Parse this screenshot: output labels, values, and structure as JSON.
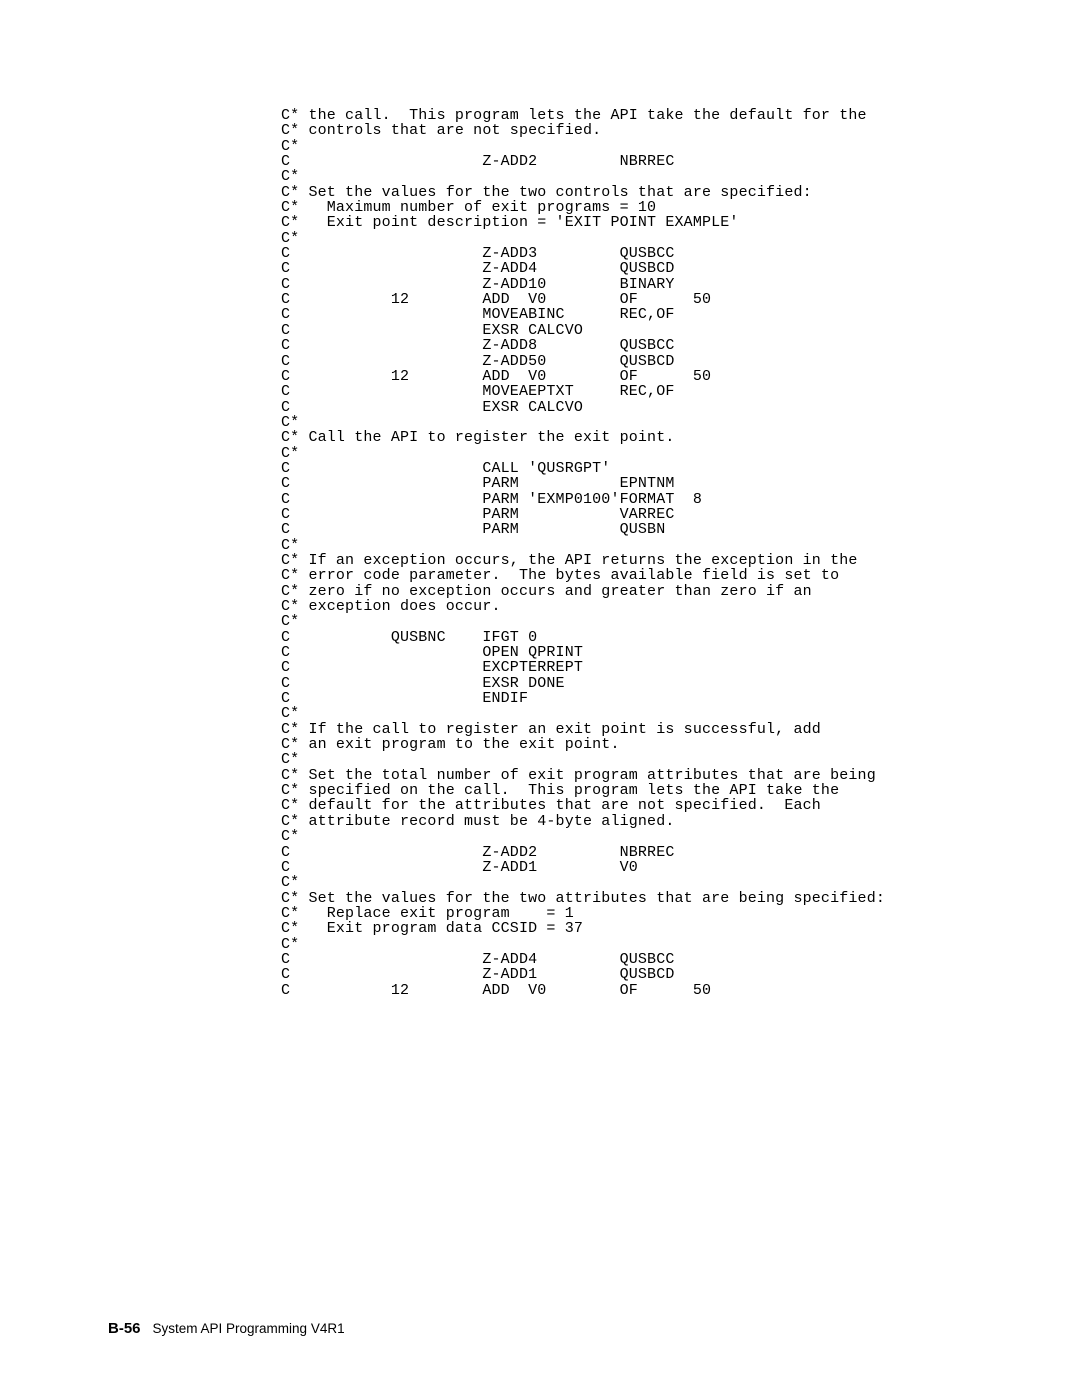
{
  "code": "C* the call.  This program lets the API take the default for the\nC* controls that are not specified.\nC*\nC                     Z-ADD2         NBRREC\nC*\nC* Set the values for the two controls that are specified:\nC*   Maximum number of exit programs = 10\nC*   Exit point description = 'EXIT POINT EXAMPLE'\nC*\nC                     Z-ADD3         QUSBCC\nC                     Z-ADD4         QUSBCD\nC                     Z-ADD10        BINARY\nC           12        ADD  V0        OF      50\nC                     MOVEABINC      REC,OF\nC                     EXSR CALCVO\nC                     Z-ADD8         QUSBCC\nC                     Z-ADD50        QUSBCD\nC           12        ADD  V0        OF      50\nC                     MOVEAEPTXT     REC,OF\nC                     EXSR CALCVO\nC*\nC* Call the API to register the exit point.\nC*\nC                     CALL 'QUSRGPT'\nC                     PARM           EPNTNM\nC                     PARM 'EXMP0100'FORMAT  8\nC                     PARM           VARREC\nC                     PARM           QUSBN\nC*\nC* If an exception occurs, the API returns the exception in the\nC* error code parameter.  The bytes available field is set to\nC* zero if no exception occurs and greater than zero if an\nC* exception does occur.\nC*\nC           QUSBNC    IFGT 0\nC                     OPEN QPRINT\nC                     EXCPTERREPT\nC                     EXSR DONE\nC                     ENDIF\nC*\nC* If the call to register an exit point is successful, add\nC* an exit program to the exit point.\nC*\nC* Set the total number of exit program attributes that are being\nC* specified on the call.  This program lets the API take the\nC* default for the attributes that are not specified.  Each\nC* attribute record must be 4-byte aligned.\nC*\nC                     Z-ADD2         NBRREC\nC                     Z-ADD1         V0\nC*\nC* Set the values for the two attributes that are being specified:\nC*   Replace exit program    = 1\nC*   Exit program data CCSID = 37\nC*\nC                     Z-ADD4         QUSBCC\nC                     Z-ADD1         QUSBCD\nC           12        ADD  V0        OF      50",
  "footer": {
    "page_num": "B-56",
    "title": "System API Programming V4R1"
  }
}
